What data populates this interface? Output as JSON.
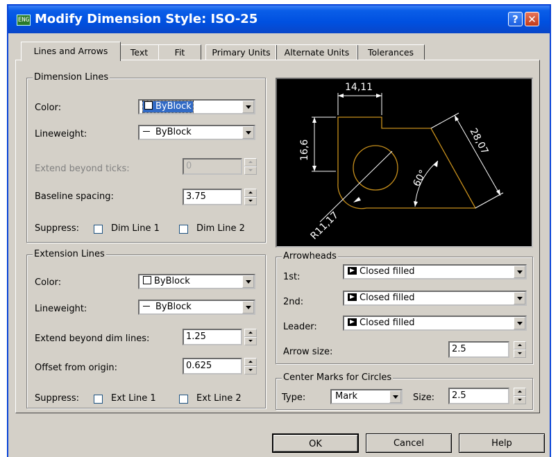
{
  "window": {
    "title": "Modify Dimension Style: ISO-25",
    "help_glyph": "?",
    "close_glyph": "✕",
    "icon_text": "ENG"
  },
  "tabs": [
    {
      "label": "Lines and Arrows"
    },
    {
      "label": "Text"
    },
    {
      "label": "Fit"
    },
    {
      "label": "Primary Units"
    },
    {
      "label": "Alternate Units"
    },
    {
      "label": "Tolerances"
    }
  ],
  "dimension_lines": {
    "title": "Dimension Lines",
    "color_label": "Color:",
    "color_value": "ByBlock",
    "lineweight_label": "Lineweight:",
    "lineweight_value": "ByBlock",
    "extend_label": "Extend beyond ticks:",
    "extend_value": "0",
    "baseline_label": "Baseline spacing:",
    "baseline_value": "3.75",
    "suppress_label": "Suppress:",
    "dim_line1": "Dim Line 1",
    "dim_line2": "Dim Line 2"
  },
  "extension_lines": {
    "title": "Extension Lines",
    "color_label": "Color:",
    "color_value": "ByBlock",
    "lineweight_label": "Lineweight:",
    "lineweight_value": "ByBlock",
    "extend_label": "Extend beyond dim lines:",
    "extend_value": "1.25",
    "offset_label": "Offset from origin:",
    "offset_value": "0.625",
    "suppress_label": "Suppress:",
    "ext_line1": "Ext Line 1",
    "ext_line2": "Ext Line 2"
  },
  "preview": {
    "dim_top": "14,11",
    "dim_left": "16,6",
    "dim_right": "28,07",
    "dim_angle": "60°",
    "dim_radius": "R11,17"
  },
  "arrowheads": {
    "title": "Arrowheads",
    "first_label": "1st:",
    "first_value": "Closed filled",
    "second_label": "2nd:",
    "second_value": "Closed filled",
    "leader_label": "Leader:",
    "leader_value": "Closed filled",
    "size_label": "Arrow size:",
    "size_value": "2.5"
  },
  "center_marks": {
    "title": "Center Marks for Circles",
    "type_label": "Type:",
    "type_value": "Mark",
    "size_label": "Size:",
    "size_value": "2.5"
  },
  "buttons": {
    "ok": "OK",
    "cancel": "Cancel",
    "help": "Help"
  },
  "colors": {
    "titlebar": "#0054e3",
    "dialog_bg": "#d4d0c8",
    "selection": "#316ac5",
    "preview_geometry": "#c8901c"
  }
}
